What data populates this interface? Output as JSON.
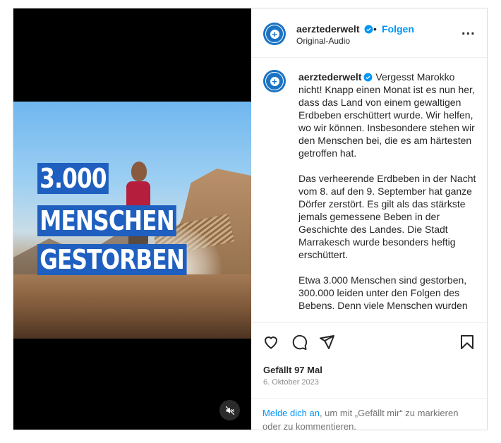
{
  "post": {
    "overlay_lines": [
      "3.000",
      "MENSCHEN",
      "GESTORBEN"
    ],
    "header": {
      "username": "aerztederwelt",
      "separator": "•",
      "follow_label": "Folgen",
      "audio_label": "Original-Audio",
      "more_label": "..."
    },
    "caption": {
      "username": "aerztederwelt",
      "paragraph_1": "Vergesst Marokko nicht! Knapp einen Monat ist es nun her, dass das Land von einem gewaltigen Erdbeben erschüttert wurde. Wir helfen, wo wir können. Insbesondere stehen wir den Menschen bei, die es am härtesten getroffen hat.",
      "paragraph_2": "Das verheerende Erdbeben in der Nacht vom 8. auf den 9. September hat ganze Dörfer zerstört. Es gilt als das stärkste jemals gemessene Beben in der Geschichte des Landes. Die Stadt Marrakesch wurde besonders heftig erschüttert.",
      "paragraph_3": "Etwa 3.000 Menschen sind gestorben, 300.000 leiden unter den Folgen des Bebens. Denn viele Menschen wurden"
    },
    "likes": "Gefällt 97 Mal",
    "date": "6. Oktober 2023",
    "login_prompt": {
      "link": "Melde dich an",
      "rest": ", um mit „Gefällt mir“ zu markieren oder zu kommentieren."
    },
    "icons": [
      "heart-icon",
      "comment-icon",
      "share-icon",
      "bookmark-icon",
      "mute-icon",
      "verified-icon",
      "more-icon"
    ],
    "colors": {
      "accent": "#0095f6",
      "overlay": "#1f5fbf",
      "brand": "#1a73c4",
      "verified": "#0095f6"
    }
  }
}
